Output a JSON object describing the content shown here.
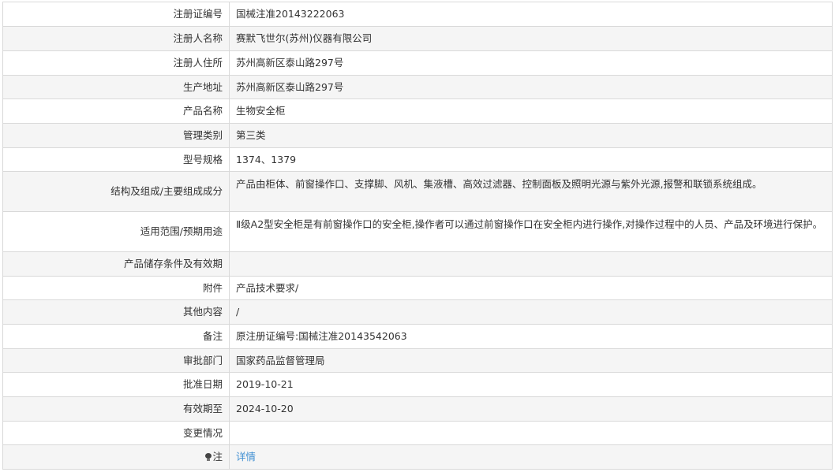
{
  "rows": [
    {
      "label": "注册证编号",
      "value": "国械注准20143222063"
    },
    {
      "label": "注册人名称",
      "value": "赛默飞世尔(苏州)仪器有限公司"
    },
    {
      "label": "注册人住所",
      "value": "苏州高新区泰山路297号"
    },
    {
      "label": "生产地址",
      "value": "苏州高新区泰山路297号"
    },
    {
      "label": "产品名称",
      "value": "生物安全柜"
    },
    {
      "label": "管理类别",
      "value": "第三类"
    },
    {
      "label": "型号规格",
      "value": "1374、1379"
    },
    {
      "label": "结构及组成/主要组成成分",
      "value": "产品由柜体、前窗操作口、支撑脚、风机、集液槽、高效过滤器、控制面板及照明光源与紫外光源,报警和联锁系统组成。"
    },
    {
      "label": "适用范围/预期用途",
      "value": "Ⅱ级A2型安全柜是有前窗操作口的安全柜,操作者可以通过前窗操作口在安全柜内进行操作,对操作过程中的人员、产品及环境进行保护。"
    },
    {
      "label": "产品储存条件及有效期",
      "value": ""
    },
    {
      "label": "附件",
      "value": "产品技术要求/"
    },
    {
      "label": "其他内容",
      "value": "/"
    },
    {
      "label": "备注",
      "value": "原注册证编号:国械注准20143542063"
    },
    {
      "label": "审批部门",
      "value": "国家药品监督管理局"
    },
    {
      "label": "批准日期",
      "value": "2019-10-21"
    },
    {
      "label": "有效期至",
      "value": "2024-10-20"
    },
    {
      "label": "变更情况",
      "value": ""
    },
    {
      "label": "注",
      "value": "详情"
    }
  ]
}
